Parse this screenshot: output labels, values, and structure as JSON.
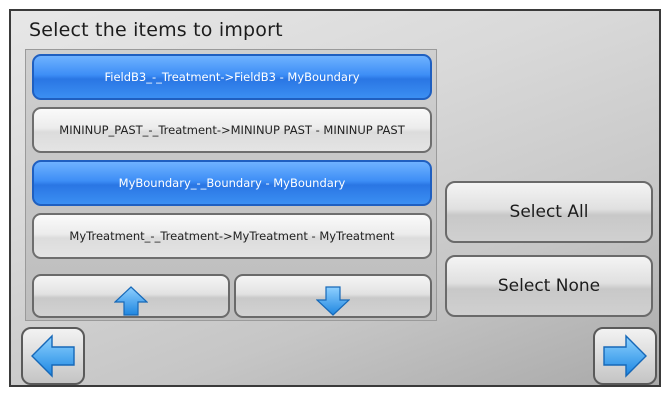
{
  "title": "Select the items to import",
  "items": [
    {
      "label": "FieldB3_-_Treatment->FieldB3 - MyBoundary",
      "selected": true
    },
    {
      "label": "MININUP_PAST_-_Treatment->MININUP PAST - MININUP PAST",
      "selected": false
    },
    {
      "label": "MyBoundary_-_Boundary - MyBoundary",
      "selected": true
    },
    {
      "label": "MyTreatment_-_Treatment->MyTreatment - MyTreatment",
      "selected": false
    }
  ],
  "buttons": {
    "select_all": "Select All",
    "select_none": "Select None"
  },
  "icons": {
    "scroll_up": "arrow-up-icon",
    "scroll_down": "arrow-down-icon",
    "back": "arrow-left-icon",
    "next": "arrow-right-icon"
  },
  "colors": {
    "selected_item": "#3d8ef6",
    "arrow_fill": "#3aa8f2"
  }
}
